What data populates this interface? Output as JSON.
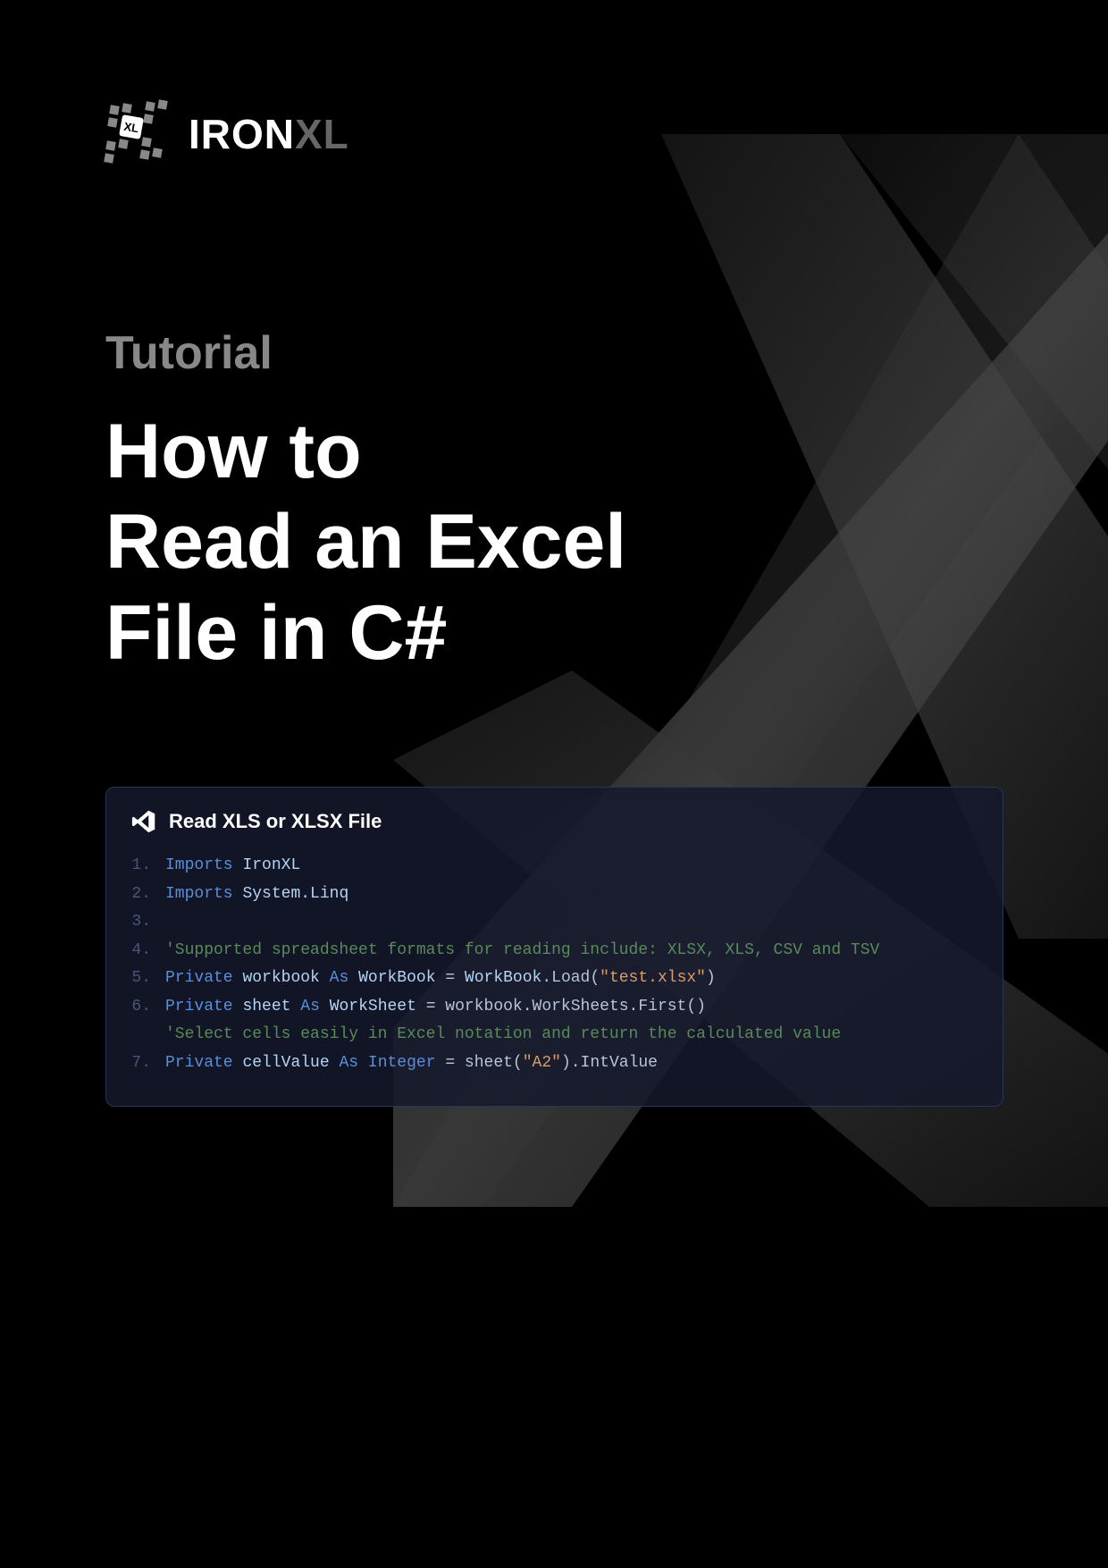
{
  "brand": {
    "name_part1": "IRON",
    "name_part2": "XL"
  },
  "subtitle": "Tutorial",
  "title": "How to\nRead an Excel\nFile in C#",
  "code_panel": {
    "title": "Read XLS or XLSX File",
    "lines": [
      {
        "num": "1.",
        "segments": [
          {
            "cls": "kw",
            "t": "Imports"
          },
          {
            "cls": "plain",
            "t": " "
          },
          {
            "cls": "cls",
            "t": "IronXL"
          }
        ]
      },
      {
        "num": "2.",
        "segments": [
          {
            "cls": "kw",
            "t": "Imports"
          },
          {
            "cls": "plain",
            "t": " "
          },
          {
            "cls": "cls",
            "t": "System.Linq"
          }
        ]
      },
      {
        "num": "3.",
        "segments": []
      },
      {
        "num": "4.",
        "segments": [
          {
            "cls": "cmt",
            "t": "'Supported spreadsheet formats for reading include: XLSX, XLS, CSV and TSV"
          }
        ]
      },
      {
        "num": "5.",
        "segments": [
          {
            "cls": "kw",
            "t": "Private"
          },
          {
            "cls": "plain",
            "t": " "
          },
          {
            "cls": "cls",
            "t": "workbook"
          },
          {
            "cls": "plain",
            "t": " "
          },
          {
            "cls": "kw",
            "t": "As"
          },
          {
            "cls": "plain",
            "t": " "
          },
          {
            "cls": "cls",
            "t": "WorkBook"
          },
          {
            "cls": "plain",
            "t": " = "
          },
          {
            "cls": "cls",
            "t": "WorkBook"
          },
          {
            "cls": "plain",
            "t": ".Load("
          },
          {
            "cls": "str",
            "t": "\"test.xlsx\""
          },
          {
            "cls": "plain",
            "t": ")"
          }
        ]
      },
      {
        "num": "6.",
        "segments": [
          {
            "cls": "kw",
            "t": "Private"
          },
          {
            "cls": "plain",
            "t": " "
          },
          {
            "cls": "cls",
            "t": "sheet"
          },
          {
            "cls": "plain",
            "t": " "
          },
          {
            "cls": "kw",
            "t": "As"
          },
          {
            "cls": "plain",
            "t": " "
          },
          {
            "cls": "cls",
            "t": "WorkSheet"
          },
          {
            "cls": "plain",
            "t": " = workbook.WorkSheets.First()"
          }
        ]
      },
      {
        "num": "",
        "segments": [
          {
            "cls": "cmt",
            "t": "'Select cells easily in Excel notation and return the calculated value"
          }
        ],
        "indent": true
      },
      {
        "num": "7.",
        "segments": [
          {
            "cls": "kw",
            "t": "Private"
          },
          {
            "cls": "plain",
            "t": " "
          },
          {
            "cls": "cls",
            "t": "cellValue"
          },
          {
            "cls": "plain",
            "t": " "
          },
          {
            "cls": "kw",
            "t": "As"
          },
          {
            "cls": "plain",
            "t": " "
          },
          {
            "cls": "kw",
            "t": "Integer"
          },
          {
            "cls": "plain",
            "t": " = sheet("
          },
          {
            "cls": "str",
            "t": "\"A2\""
          },
          {
            "cls": "plain",
            "t": ").IntValue"
          }
        ]
      }
    ]
  }
}
